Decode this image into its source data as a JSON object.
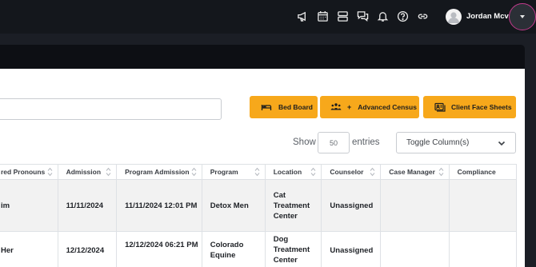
{
  "header": {
    "user_name": "Jordan Mcvay",
    "icons": [
      "megaphone-icon",
      "calendar-icon",
      "server-icon",
      "chat-icon",
      "bell-icon",
      "help-icon",
      "link-icon"
    ]
  },
  "toolbar": {
    "bed_board_label": "Bed Board",
    "census_plus": "+",
    "census_label": "Advanced Census",
    "face_sheets_label": "Client Face Sheets"
  },
  "entries": {
    "show_label": "Show",
    "count": "50",
    "entries_label": "entries"
  },
  "toggle_columns_label": "Toggle Column(s)",
  "table": {
    "headers": [
      "red Pronouns",
      "Admission",
      "Program Admission",
      "Program",
      "Location",
      "Counselor",
      "Case Manager",
      "Compliance"
    ],
    "rows": [
      [
        "im",
        "11/11/2024",
        "11/11/2024 12:01 PM",
        "Detox Men",
        "Cat Treatment Center",
        "Unassigned",
        "",
        ""
      ],
      [
        "Her",
        "12/12/2024",
        "12/12/2024 06:21 PM",
        "Colorado Equine",
        "Dog Treatment Center",
        "Unassigned",
        "",
        ""
      ]
    ]
  }
}
